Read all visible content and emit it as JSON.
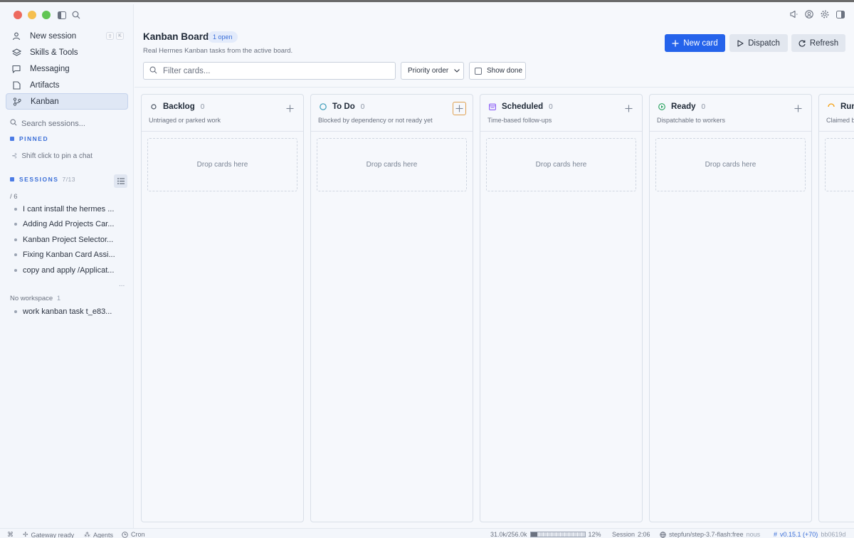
{
  "sidebar": {
    "nav": [
      {
        "label": "New session",
        "icon": "new-session-icon",
        "shortcut": [
          "⇧",
          "K"
        ]
      },
      {
        "label": "Skills & Tools",
        "icon": "skills-icon"
      },
      {
        "label": "Messaging",
        "icon": "messaging-icon"
      },
      {
        "label": "Artifacts",
        "icon": "artifacts-icon"
      },
      {
        "label": "Kanban",
        "icon": "kanban-icon",
        "active": true
      }
    ],
    "search_placeholder": "Search sessions...",
    "pinned_label": "PINNED",
    "pin_hint": "Shift click to pin a chat",
    "sessions_label": "SESSIONS",
    "sessions_count": "7/13",
    "group1_label": "/ 6",
    "group1_sessions": [
      "I cant install the hermes ...",
      "Adding Add Projects Car...",
      "Kanban Project Selector...",
      "Fixing Kanban Card Assi...",
      "copy and apply /Applicat..."
    ],
    "more": "...",
    "group2_label": "No workspace",
    "group2_count": "1",
    "group2_sessions": [
      "work kanban task t_e83..."
    ]
  },
  "header": {
    "title": "Kanban Board",
    "badge": "1 open",
    "subtitle": "Real Hermes Kanban tasks from the active board.",
    "new_card": "New card",
    "dispatch": "Dispatch",
    "refresh": "Refresh"
  },
  "toolbar": {
    "filter_placeholder": "Filter cards...",
    "sort_value": "Priority order",
    "show_done": "Show done"
  },
  "columns": [
    {
      "title": "Backlog",
      "count": "0",
      "desc": "Untriaged or parked work",
      "icon": "backlog-icon",
      "drop": "Drop cards here"
    },
    {
      "title": "To Do",
      "count": "0",
      "desc": "Blocked by dependency or not ready yet",
      "icon": "todo-icon",
      "drop": "Drop cards here"
    },
    {
      "title": "Scheduled",
      "count": "0",
      "desc": "Time-based follow-ups",
      "icon": "calendar-icon",
      "drop": "Drop cards here"
    },
    {
      "title": "Ready",
      "count": "0",
      "desc": "Dispatchable to workers",
      "icon": "play-icon",
      "drop": "Drop cards here"
    },
    {
      "title": "Runn",
      "count": "",
      "desc": "Claimed b",
      "icon": "running-icon",
      "drop": ""
    }
  ],
  "statusbar": {
    "gateway": "Gateway ready",
    "agents": "Agents",
    "cron": "Cron",
    "tokens": "31.0k/256.0k",
    "ctx_percent": "12%",
    "session": "Session",
    "session_time": "2:06",
    "model": "stepfun/step-3.7-flash:free",
    "provider": "nous",
    "version": "v0.15.1 (+70)",
    "commit": "bb0619d"
  },
  "colors": {
    "accent": "#2563eb",
    "focus": "#e0a050",
    "ready": "#22a05a",
    "scheduled": "#8b5cf6",
    "running": "#f59e0b"
  }
}
